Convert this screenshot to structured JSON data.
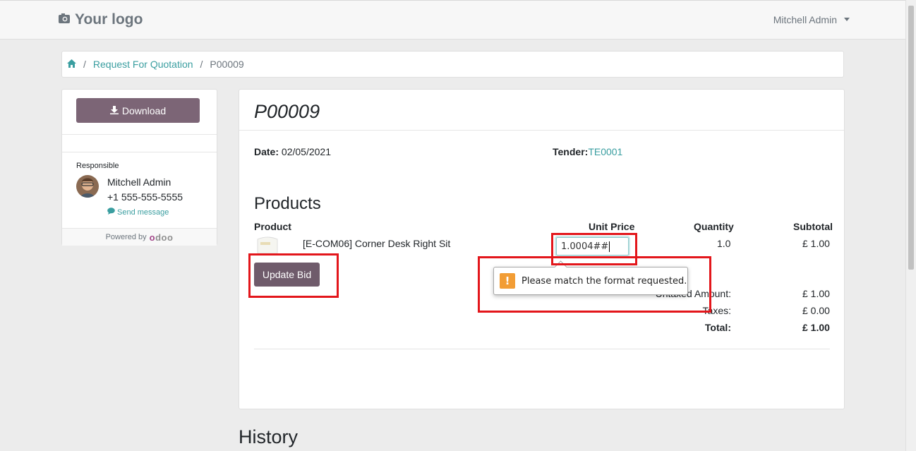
{
  "header": {
    "logo_text": "Your logo",
    "user_name": "Mitchell Admin"
  },
  "breadcrumb": {
    "items": [
      "Request For Quotation"
    ],
    "current": "P00009"
  },
  "sidebar": {
    "download_label": "Download",
    "responsible_label": "Responsible",
    "responsible_name": "Mitchell Admin",
    "responsible_phone": "+1 555-555-5555",
    "send_message_label": "Send message",
    "powered_by_label": "Powered by",
    "powered_by_brand": "odoo"
  },
  "document": {
    "title": "P00009",
    "date_label": "Date:",
    "date_value": "02/05/2021",
    "tender_label": "Tender:",
    "tender_value": "TE0001",
    "products_title": "Products",
    "columns": {
      "product": "Product",
      "unit_price": "Unit Price",
      "quantity": "Quantity",
      "subtotal": "Subtotal"
    },
    "line": {
      "product": "[E-COM06] Corner Desk Right Sit",
      "unit_price_input": "1.0004##",
      "quantity": "1.0",
      "subtotal": "£ 1.00"
    },
    "update_bid_label": "Update Bid",
    "totals": {
      "untaxed_label": "Untaxed Amount:",
      "untaxed_value": "£ 1.00",
      "taxes_label": "Taxes:",
      "taxes_value": "£ 0.00",
      "total_label": "Total:",
      "total_value": "£ 1.00"
    }
  },
  "validation": {
    "message": "Please match the format requested."
  },
  "history_title": "History",
  "colors": {
    "accent": "#3a9ea0",
    "button": "#7c6576",
    "highlight": "#e3161b",
    "warning": "#f29d35"
  },
  "icons": [
    "camera-icon",
    "caret-down-icon",
    "home-icon",
    "download-icon",
    "comment-icon",
    "warning-icon"
  ]
}
